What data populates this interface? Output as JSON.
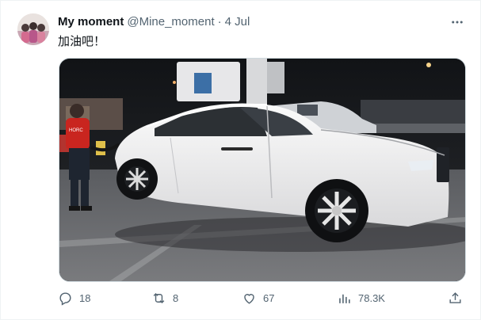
{
  "tweet": {
    "display_name": "My moment",
    "handle": "@Mine_moment",
    "separator": "·",
    "date": "4 Jul",
    "text": "加油吧！",
    "more_icon": "more-dots-icon",
    "media": {
      "visible_text": [
        "HORC"
      ]
    },
    "actions": {
      "replies": "18",
      "retweets": "8",
      "likes": "67",
      "views": "78.3K"
    },
    "icons": [
      "reply-icon",
      "retweet-icon",
      "like-icon",
      "views-icon",
      "share-icon"
    ],
    "colors": {
      "text": "#0f1419",
      "secondary": "#536471",
      "border": "#cfd9de"
    }
  }
}
